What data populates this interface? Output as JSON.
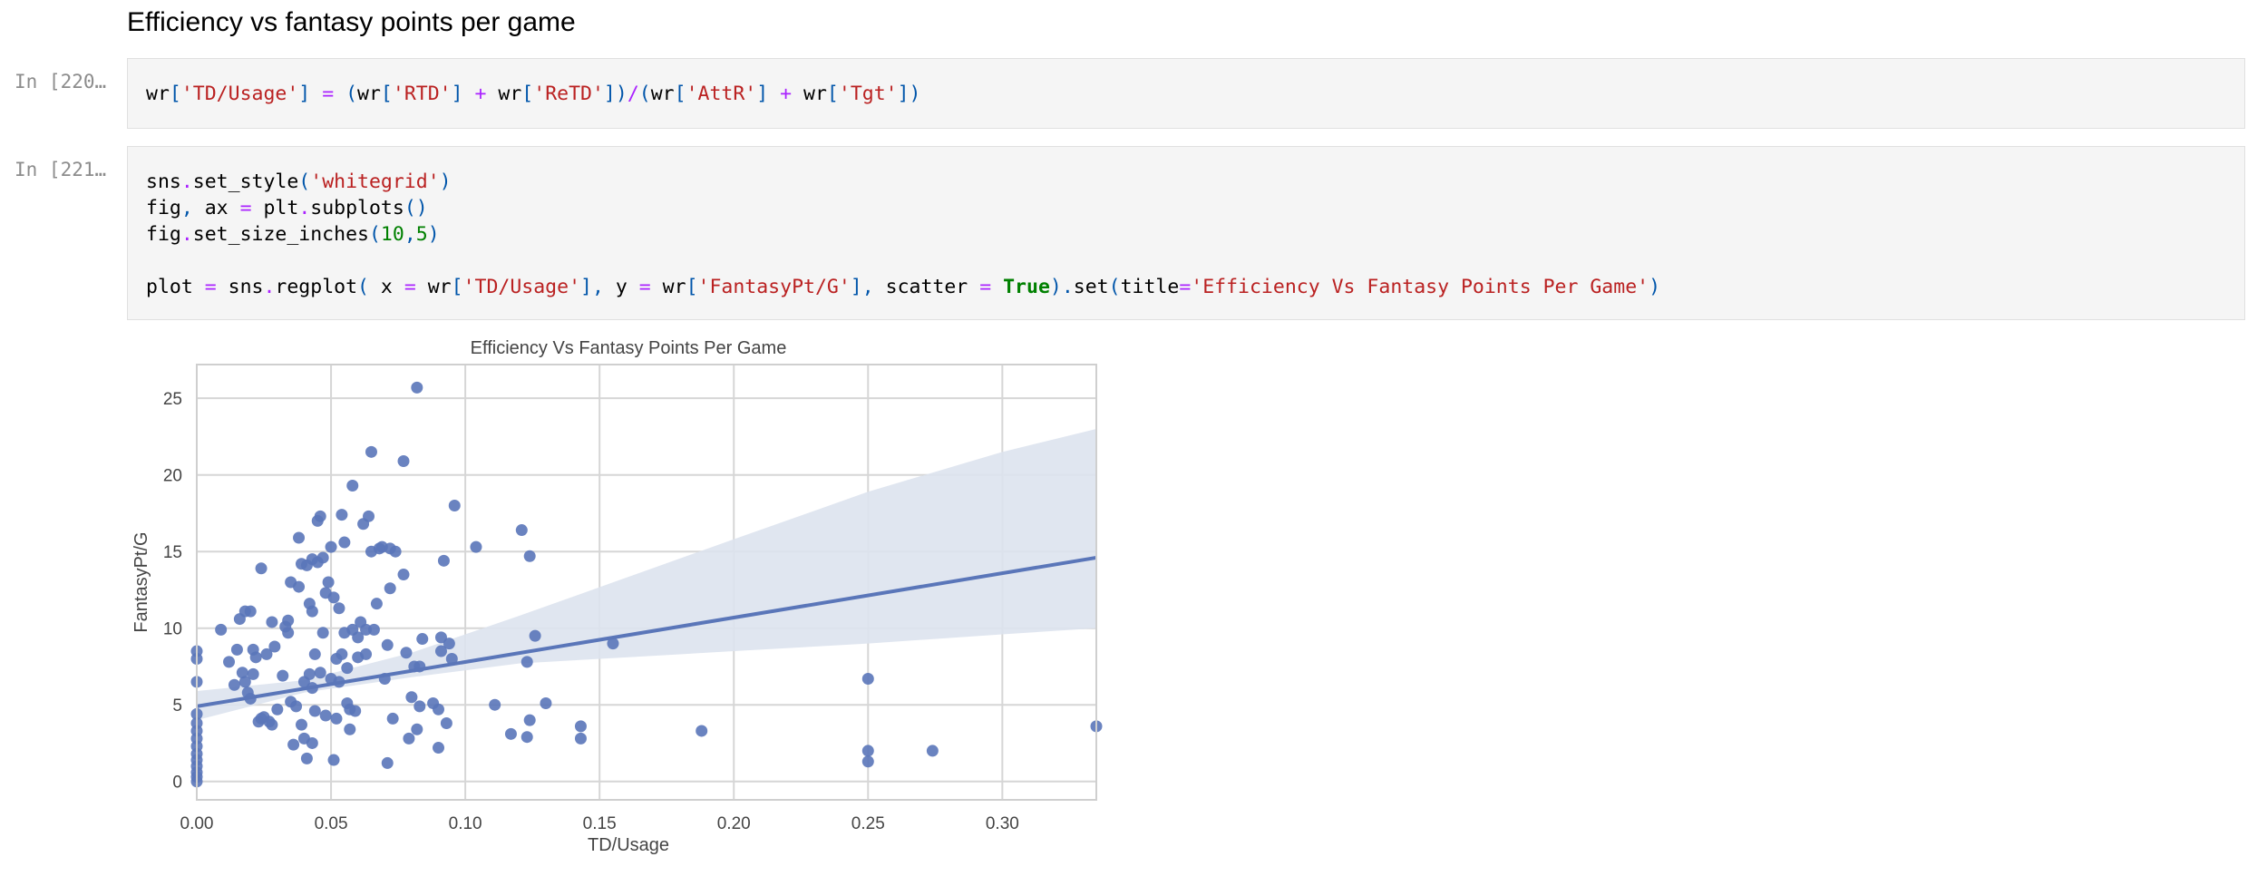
{
  "notebook": {
    "section_heading": "Efficiency vs fantasy points per game",
    "cells": [
      {
        "prompt": "In [220…",
        "code_tokens": [
          {
            "t": "wr",
            "c": ""
          },
          {
            "t": "[",
            "c": "p"
          },
          {
            "t": "'TD/Usage'",
            "c": "s"
          },
          {
            "t": "] ",
            "c": "p"
          },
          {
            "t": "=",
            "c": "o"
          },
          {
            "t": " (",
            "c": "p"
          },
          {
            "t": "wr",
            "c": ""
          },
          {
            "t": "[",
            "c": "p"
          },
          {
            "t": "'RTD'",
            "c": "s"
          },
          {
            "t": "] ",
            "c": "p"
          },
          {
            "t": "+",
            "c": "o"
          },
          {
            "t": " wr",
            "c": ""
          },
          {
            "t": "[",
            "c": "p"
          },
          {
            "t": "'ReTD'",
            "c": "s"
          },
          {
            "t": "])",
            "c": "p"
          },
          {
            "t": "/",
            "c": "o"
          },
          {
            "t": "(",
            "c": "p"
          },
          {
            "t": "wr",
            "c": ""
          },
          {
            "t": "[",
            "c": "p"
          },
          {
            "t": "'AttR'",
            "c": "s"
          },
          {
            "t": "] ",
            "c": "p"
          },
          {
            "t": "+",
            "c": "o"
          },
          {
            "t": " wr",
            "c": ""
          },
          {
            "t": "[",
            "c": "p"
          },
          {
            "t": "'Tgt'",
            "c": "s"
          },
          {
            "t": "])",
            "c": "p"
          }
        ]
      },
      {
        "prompt": "In [221…",
        "lines": [
          [
            {
              "t": "sns",
              "c": ""
            },
            {
              "t": ".",
              "c": "o"
            },
            {
              "t": "set_style",
              "c": ""
            },
            {
              "t": "(",
              "c": "p"
            },
            {
              "t": "'whitegrid'",
              "c": "s"
            },
            {
              "t": ")",
              "c": "p"
            }
          ],
          [
            {
              "t": "fig",
              "c": ""
            },
            {
              "t": ",",
              "c": "p"
            },
            {
              "t": " ax ",
              "c": ""
            },
            {
              "t": "=",
              "c": "o"
            },
            {
              "t": " plt",
              "c": ""
            },
            {
              "t": ".",
              "c": "o"
            },
            {
              "t": "subplots",
              "c": ""
            },
            {
              "t": "()",
              "c": "p"
            }
          ],
          [
            {
              "t": "fig",
              "c": ""
            },
            {
              "t": ".",
              "c": "o"
            },
            {
              "t": "set_size_inches",
              "c": ""
            },
            {
              "t": "(",
              "c": "p"
            },
            {
              "t": "10",
              "c": "n"
            },
            {
              "t": ",",
              "c": "p"
            },
            {
              "t": "5",
              "c": "n"
            },
            {
              "t": ")",
              "c": "p"
            }
          ],
          [],
          [
            {
              "t": "plot ",
              "c": ""
            },
            {
              "t": "=",
              "c": "o"
            },
            {
              "t": " sns",
              "c": ""
            },
            {
              "t": ".",
              "c": "o"
            },
            {
              "t": "regplot",
              "c": ""
            },
            {
              "t": "(",
              "c": "p"
            },
            {
              "t": " x ",
              "c": ""
            },
            {
              "t": "=",
              "c": "o"
            },
            {
              "t": " wr",
              "c": ""
            },
            {
              "t": "[",
              "c": "p"
            },
            {
              "t": "'TD/Usage'",
              "c": "s"
            },
            {
              "t": "], ",
              "c": "p"
            },
            {
              "t": "y ",
              "c": ""
            },
            {
              "t": "=",
              "c": "o"
            },
            {
              "t": " wr",
              "c": ""
            },
            {
              "t": "[",
              "c": "p"
            },
            {
              "t": "'FantasyPt/G'",
              "c": "s"
            },
            {
              "t": "], ",
              "c": "p"
            },
            {
              "t": "scatter ",
              "c": ""
            },
            {
              "t": "=",
              "c": "o"
            },
            {
              "t": " ",
              "c": ""
            },
            {
              "t": "True",
              "c": "k"
            },
            {
              "t": ").",
              "c": "p"
            },
            {
              "t": "set",
              "c": ""
            },
            {
              "t": "(",
              "c": "p"
            },
            {
              "t": "title",
              "c": ""
            },
            {
              "t": "=",
              "c": "o"
            },
            {
              "t": "'Efficiency Vs Fantasy Points Per Game'",
              "c": "s"
            },
            {
              "t": ")",
              "c": "p"
            }
          ]
        ]
      }
    ]
  },
  "chart_data": {
    "type": "scatter",
    "title": "Efficiency Vs Fantasy Points Per Game",
    "xlabel": "TD/Usage",
    "ylabel": "FantasyPt/G",
    "xlim": [
      0,
      0.335
    ],
    "ylim": [
      -1.2,
      27.2
    ],
    "xticks": [
      0.0,
      0.05,
      0.1,
      0.15,
      0.2,
      0.25,
      0.3
    ],
    "xtick_labels": [
      "0.00",
      "0.05",
      "0.10",
      "0.15",
      "0.20",
      "0.25",
      "0.30"
    ],
    "yticks": [
      0,
      5,
      10,
      15,
      20,
      25
    ],
    "ytick_labels": [
      "0",
      "5",
      "10",
      "15",
      "20",
      "25"
    ],
    "grid": true,
    "point_color": "#5a76b9",
    "line_color": "#5a76b9",
    "band_color": "#dde3ee",
    "regression": {
      "x": [
        0.0,
        0.335
      ],
      "y": [
        4.9,
        14.6
      ]
    },
    "ci_band": {
      "x": [
        0.0,
        0.04,
        0.08,
        0.12,
        0.16,
        0.2,
        0.25,
        0.3,
        0.335
      ],
      "upper": [
        5.9,
        6.6,
        8.4,
        10.8,
        13.3,
        15.8,
        18.9,
        21.5,
        23.0
      ],
      "lower": [
        4.0,
        5.8,
        6.8,
        7.7,
        8.1,
        8.5,
        9.0,
        9.6,
        10.0
      ]
    },
    "points": [
      [
        0.0,
        0.0
      ],
      [
        0.0,
        0.3
      ],
      [
        0.0,
        0.6
      ],
      [
        0.0,
        1.0
      ],
      [
        0.0,
        1.4
      ],
      [
        0.0,
        1.8
      ],
      [
        0.0,
        2.3
      ],
      [
        0.0,
        2.8
      ],
      [
        0.0,
        3.3
      ],
      [
        0.0,
        3.8
      ],
      [
        0.0,
        4.4
      ],
      [
        0.0,
        6.5
      ],
      [
        0.0,
        8.0
      ],
      [
        0.0,
        8.5
      ],
      [
        0.009,
        9.9
      ],
      [
        0.012,
        7.8
      ],
      [
        0.014,
        6.3
      ],
      [
        0.015,
        8.6
      ],
      [
        0.016,
        10.6
      ],
      [
        0.017,
        7.1
      ],
      [
        0.018,
        11.1
      ],
      [
        0.018,
        6.5
      ],
      [
        0.019,
        5.8
      ],
      [
        0.02,
        5.4
      ],
      [
        0.02,
        11.1
      ],
      [
        0.021,
        7.0
      ],
      [
        0.021,
        8.6
      ],
      [
        0.022,
        8.1
      ],
      [
        0.023,
        3.9
      ],
      [
        0.024,
        4.1
      ],
      [
        0.024,
        13.9
      ],
      [
        0.025,
        4.2
      ],
      [
        0.026,
        8.3
      ],
      [
        0.027,
        3.9
      ],
      [
        0.028,
        3.7
      ],
      [
        0.028,
        10.4
      ],
      [
        0.029,
        8.8
      ],
      [
        0.03,
        4.7
      ],
      [
        0.032,
        6.9
      ],
      [
        0.033,
        10.1
      ],
      [
        0.034,
        10.5
      ],
      [
        0.034,
        9.7
      ],
      [
        0.035,
        5.2
      ],
      [
        0.035,
        13.0
      ],
      [
        0.036,
        2.4
      ],
      [
        0.037,
        4.9
      ],
      [
        0.038,
        12.7
      ],
      [
        0.038,
        15.9
      ],
      [
        0.039,
        3.7
      ],
      [
        0.039,
        14.2
      ],
      [
        0.04,
        6.5
      ],
      [
        0.04,
        2.8
      ],
      [
        0.041,
        14.1
      ],
      [
        0.041,
        1.5
      ],
      [
        0.042,
        11.6
      ],
      [
        0.042,
        7.0
      ],
      [
        0.043,
        2.5
      ],
      [
        0.043,
        14.5
      ],
      [
        0.043,
        6.1
      ],
      [
        0.043,
        11.1
      ],
      [
        0.044,
        4.6
      ],
      [
        0.044,
        8.3
      ],
      [
        0.045,
        14.3
      ],
      [
        0.045,
        17.0
      ],
      [
        0.046,
        17.3
      ],
      [
        0.046,
        7.1
      ],
      [
        0.047,
        14.6
      ],
      [
        0.047,
        9.7
      ],
      [
        0.048,
        4.3
      ],
      [
        0.048,
        12.3
      ],
      [
        0.049,
        13.0
      ],
      [
        0.05,
        15.3
      ],
      [
        0.05,
        6.7
      ],
      [
        0.051,
        1.4
      ],
      [
        0.051,
        12.0
      ],
      [
        0.052,
        4.1
      ],
      [
        0.052,
        8.0
      ],
      [
        0.053,
        11.3
      ],
      [
        0.053,
        6.5
      ],
      [
        0.054,
        8.3
      ],
      [
        0.054,
        17.4
      ],
      [
        0.055,
        9.7
      ],
      [
        0.055,
        15.6
      ],
      [
        0.056,
        5.1
      ],
      [
        0.056,
        7.4
      ],
      [
        0.057,
        4.7
      ],
      [
        0.057,
        3.4
      ],
      [
        0.058,
        19.3
      ],
      [
        0.058,
        9.9
      ],
      [
        0.059,
        4.6
      ],
      [
        0.06,
        8.1
      ],
      [
        0.06,
        9.4
      ],
      [
        0.061,
        10.4
      ],
      [
        0.062,
        16.8
      ],
      [
        0.063,
        9.9
      ],
      [
        0.063,
        8.3
      ],
      [
        0.064,
        17.3
      ],
      [
        0.065,
        15.0
      ],
      [
        0.065,
        21.5
      ],
      [
        0.066,
        9.9
      ],
      [
        0.067,
        11.6
      ],
      [
        0.068,
        15.2
      ],
      [
        0.069,
        15.3
      ],
      [
        0.07,
        6.7
      ],
      [
        0.071,
        1.2
      ],
      [
        0.071,
        8.9
      ],
      [
        0.072,
        15.2
      ],
      [
        0.072,
        12.6
      ],
      [
        0.073,
        4.1
      ],
      [
        0.074,
        15.0
      ],
      [
        0.077,
        13.5
      ],
      [
        0.077,
        20.9
      ],
      [
        0.078,
        8.4
      ],
      [
        0.079,
        2.8
      ],
      [
        0.08,
        5.5
      ],
      [
        0.081,
        7.5
      ],
      [
        0.082,
        25.7
      ],
      [
        0.082,
        3.4
      ],
      [
        0.083,
        7.5
      ],
      [
        0.083,
        4.9
      ],
      [
        0.084,
        9.3
      ],
      [
        0.088,
        5.1
      ],
      [
        0.09,
        4.7
      ],
      [
        0.09,
        2.2
      ],
      [
        0.091,
        9.4
      ],
      [
        0.091,
        8.5
      ],
      [
        0.092,
        14.4
      ],
      [
        0.093,
        3.8
      ],
      [
        0.094,
        9.0
      ],
      [
        0.095,
        8.0
      ],
      [
        0.096,
        18.0
      ],
      [
        0.104,
        15.3
      ],
      [
        0.111,
        5.0
      ],
      [
        0.117,
        3.1
      ],
      [
        0.121,
        16.4
      ],
      [
        0.123,
        2.9
      ],
      [
        0.123,
        7.8
      ],
      [
        0.124,
        14.7
      ],
      [
        0.124,
        4.0
      ],
      [
        0.126,
        9.5
      ],
      [
        0.13,
        5.1
      ],
      [
        0.143,
        3.6
      ],
      [
        0.143,
        2.8
      ],
      [
        0.155,
        9.0
      ],
      [
        0.188,
        3.3
      ],
      [
        0.25,
        6.7
      ],
      [
        0.25,
        2.0
      ],
      [
        0.25,
        1.3
      ],
      [
        0.274,
        2.0
      ],
      [
        0.335,
        3.6
      ]
    ]
  }
}
